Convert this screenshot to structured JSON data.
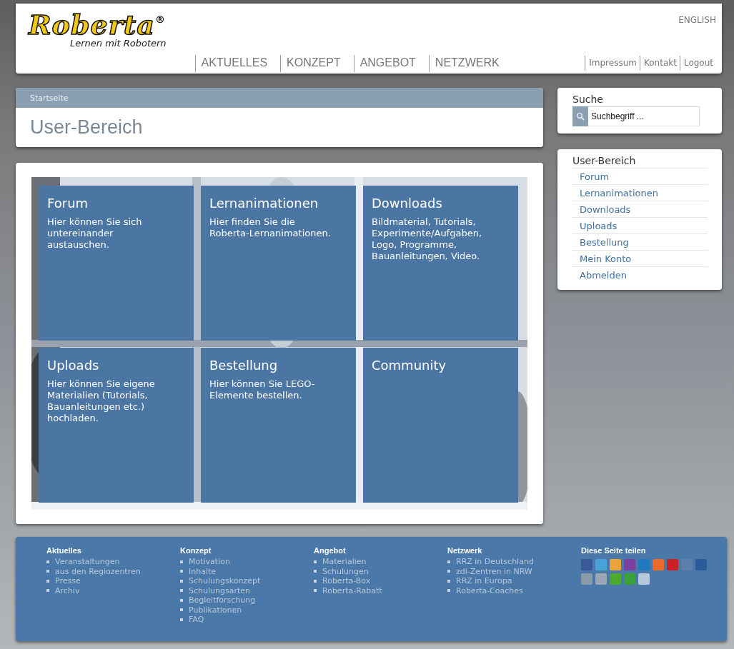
{
  "header": {
    "logo": {
      "name": "Roberta",
      "mark": "®",
      "tagline": "Lernen mit Robotern"
    },
    "language": "ENGLISH",
    "nav": [
      {
        "label": "AKTUELLES"
      },
      {
        "label": "KONZEPT"
      },
      {
        "label": "ANGEBOT"
      },
      {
        "label": "NETZWERK"
      }
    ],
    "meta_links": [
      {
        "label": "Impressum"
      },
      {
        "label": "Kontakt"
      },
      {
        "label": "Logout"
      }
    ]
  },
  "breadcrumb": [
    "Startseite"
  ],
  "page_title": "User-Bereich",
  "tiles": [
    {
      "title": "Forum",
      "text": "Hier können Sie sich untereinander austauschen."
    },
    {
      "title": "Lernanimationen",
      "text": "Hier finden Sie die Roberta-Lernanimationen."
    },
    {
      "title": "Downloads",
      "text": "Bildmaterial, Tutorials, Experimente/Aufgaben, Logo, Programme, Bauanleitungen, Video."
    },
    {
      "title": "Uploads",
      "text": "Hier können Sie eigene Materialien (Tutorials, Bauanleitungen etc.) hochladen."
    },
    {
      "title": "Bestellung",
      "text": "Hier können Sie LEGO-Elemente bestellen."
    },
    {
      "title": "Community"
    }
  ],
  "search": {
    "title": "Suche",
    "placeholder": "Suchbegriff ..."
  },
  "user_menu": {
    "title": "User-Bereich",
    "items": [
      {
        "label": "Forum"
      },
      {
        "label": "Lernanimationen"
      },
      {
        "label": "Downloads"
      },
      {
        "label": "Uploads"
      },
      {
        "label": "Bestellung"
      },
      {
        "label": "Mein Konto"
      },
      {
        "label": "Abmelden"
      }
    ]
  },
  "footer": {
    "columns": [
      {
        "title": "Aktuelles",
        "items": [
          "Veranstaltungen",
          "aus den Regiozentren",
          "Presse",
          "Archiv"
        ]
      },
      {
        "title": "Konzept",
        "items": [
          "Motivation",
          "Inhalte",
          "Schulungskonzept",
          "Schulungsarten",
          "Begleitforschung",
          "Publikationen",
          "FAQ"
        ]
      },
      {
        "title": "Angebot",
        "items": [
          "Materialien",
          "Schulungen",
          "Roberta-Box",
          "Roberta-Rabatt"
        ]
      },
      {
        "title": "Netzwerk",
        "items": [
          "RRZ in Deutschland",
          "zdi-Zentren in NRW",
          "RRZ in Europa",
          "Roberta-Coaches"
        ]
      }
    ],
    "share": {
      "title": "Diese Seite teilen",
      "icons": [
        {
          "color": "#3b5998"
        },
        {
          "color": "#4aa3d8"
        },
        {
          "color": "#e8a33a"
        },
        {
          "color": "#7b3fa0"
        },
        {
          "color": "#1f7bc1"
        },
        {
          "color": "#eb6a2c"
        },
        {
          "color": "#cb2027"
        },
        {
          "color": "#5a7fa8"
        },
        {
          "color": "#2a5a9a"
        },
        {
          "color": "#8a9aa8"
        },
        {
          "color": "#9aa6b4"
        },
        {
          "color": "#4caa2c"
        },
        {
          "color": "#3aa03a"
        },
        {
          "color": "#b8c8dc"
        }
      ]
    }
  }
}
